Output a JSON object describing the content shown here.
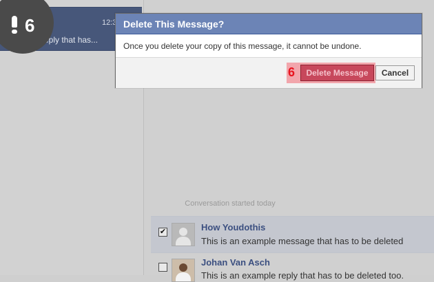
{
  "sidebar": {
    "selected_thread": {
      "time": "12:3",
      "snippet": "reply that has..."
    }
  },
  "step_badge": {
    "number": "6"
  },
  "dialog": {
    "title": "Delete This Message?",
    "body": "Once you delete your copy of this message, it cannot be undone.",
    "annotation_number": "6",
    "delete_label": "Delete Message",
    "cancel_label": "Cancel"
  },
  "conversation": {
    "started_label": "Conversation started today",
    "messages": [
      {
        "name": "How Youdothis",
        "text": "This is an example message that has to be deleted",
        "checked": true,
        "check_glyph": "✔"
      },
      {
        "name": "Johan Van Asch",
        "text": "This is an example reply that has to be deleted too.",
        "checked": false,
        "check_glyph": ""
      }
    ]
  }
}
